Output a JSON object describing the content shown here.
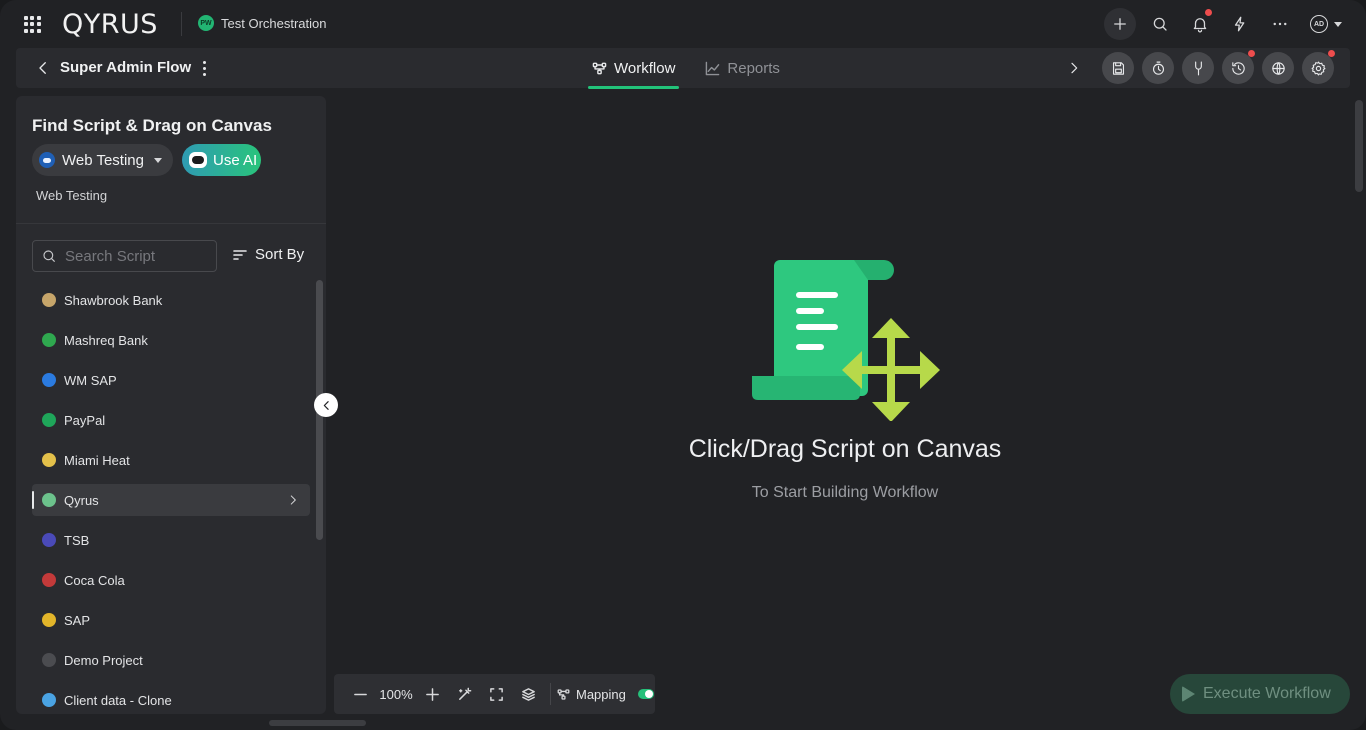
{
  "header": {
    "logo": "QYRUS",
    "project": {
      "initials": "PW",
      "name": "Test Orchestration"
    },
    "icons": [
      "plus-icon",
      "search-icon",
      "bell-icon",
      "bolt-icon",
      "more-icon"
    ],
    "user": {
      "initials": "AD"
    }
  },
  "subheader": {
    "title": "Super Admin Flow",
    "tabs": [
      {
        "label": "Workflow",
        "active": true
      },
      {
        "label": "Reports",
        "active": false
      }
    ],
    "actions": [
      "save-icon",
      "timer-icon",
      "mapping-icon",
      "history-icon",
      "globe-icon",
      "settings-icon"
    ]
  },
  "panel": {
    "title": "Find Script & Drag on Canvas",
    "module": "Web Testing",
    "ai_label": "Use AI",
    "sub_label": "Web Testing",
    "search_placeholder": "Search Script",
    "sort_label": "Sort By",
    "projects": [
      {
        "label": "Shawbrook Bank",
        "color": "#c6a56a"
      },
      {
        "label": "Mashreq Bank",
        "color": "#2fa84f"
      },
      {
        "label": "WM SAP",
        "color": "#2b7be0"
      },
      {
        "label": "PayPal",
        "color": "#1fa65a"
      },
      {
        "label": "Miami Heat",
        "color": "#e3c04a"
      },
      {
        "label": "Qyrus",
        "color": "#6cc28c",
        "selected": true
      },
      {
        "label": "TSB",
        "color": "#4a4ab8"
      },
      {
        "label": "Coca Cola",
        "color": "#c33a3a"
      },
      {
        "label": "SAP",
        "color": "#e2b52a"
      },
      {
        "label": "Demo Project",
        "color": "#4b4c50"
      },
      {
        "label": "Client data - Clone",
        "color": "#4aa3e3"
      }
    ]
  },
  "canvas": {
    "title": "Click/Drag Script on Canvas",
    "subtitle": "To Start Building Workflow"
  },
  "toolbar": {
    "zoom": "100%",
    "mapping_label": "Mapping",
    "mapping_on": true
  },
  "execute_label": "Execute Workflow",
  "colors": {
    "accent": "#22c37a",
    "badge": "#ee4d4d"
  }
}
